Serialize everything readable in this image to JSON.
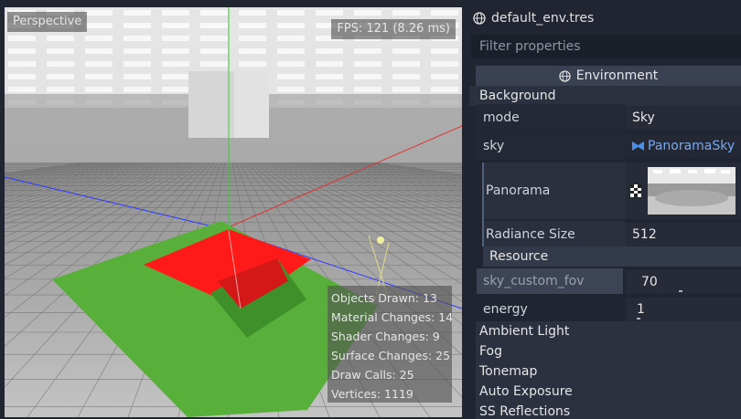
{
  "viewport": {
    "mode_label": "Perspective",
    "fps_label": "FPS: 121 (8.26 ms)",
    "stats": [
      "Objects Drawn: 13",
      "Material Changes: 14",
      "Shader Changes: 9",
      "Surface Changes: 25",
      "Draw Calls: 25",
      "Vertices: 1119"
    ]
  },
  "inspector": {
    "resource_name": "default_env.tres",
    "filter_placeholder": "Filter properties",
    "environment_header": "Environment",
    "background_section": "Background",
    "mode": {
      "label": "mode",
      "value": "Sky"
    },
    "sky": {
      "label": "sky",
      "value": "PanoramaSky"
    },
    "panorama": {
      "label": "Panorama"
    },
    "radiance_size": {
      "label": "Radiance Size",
      "value": "512"
    },
    "resource_section": "Resource",
    "sky_custom_fov": {
      "label": "sky_custom_fov",
      "value": "70"
    },
    "energy": {
      "label": "energy",
      "value": "1"
    },
    "collapsed_sections": [
      "Ambient Light",
      "Fog",
      "Tonemap",
      "Auto Exposure",
      "SS Reflections"
    ]
  },
  "colors": {
    "panel_bg": "#202531",
    "link_blue": "#79a9ee",
    "floor_green": "#58b03a",
    "box_red": "#ff1a1a"
  }
}
